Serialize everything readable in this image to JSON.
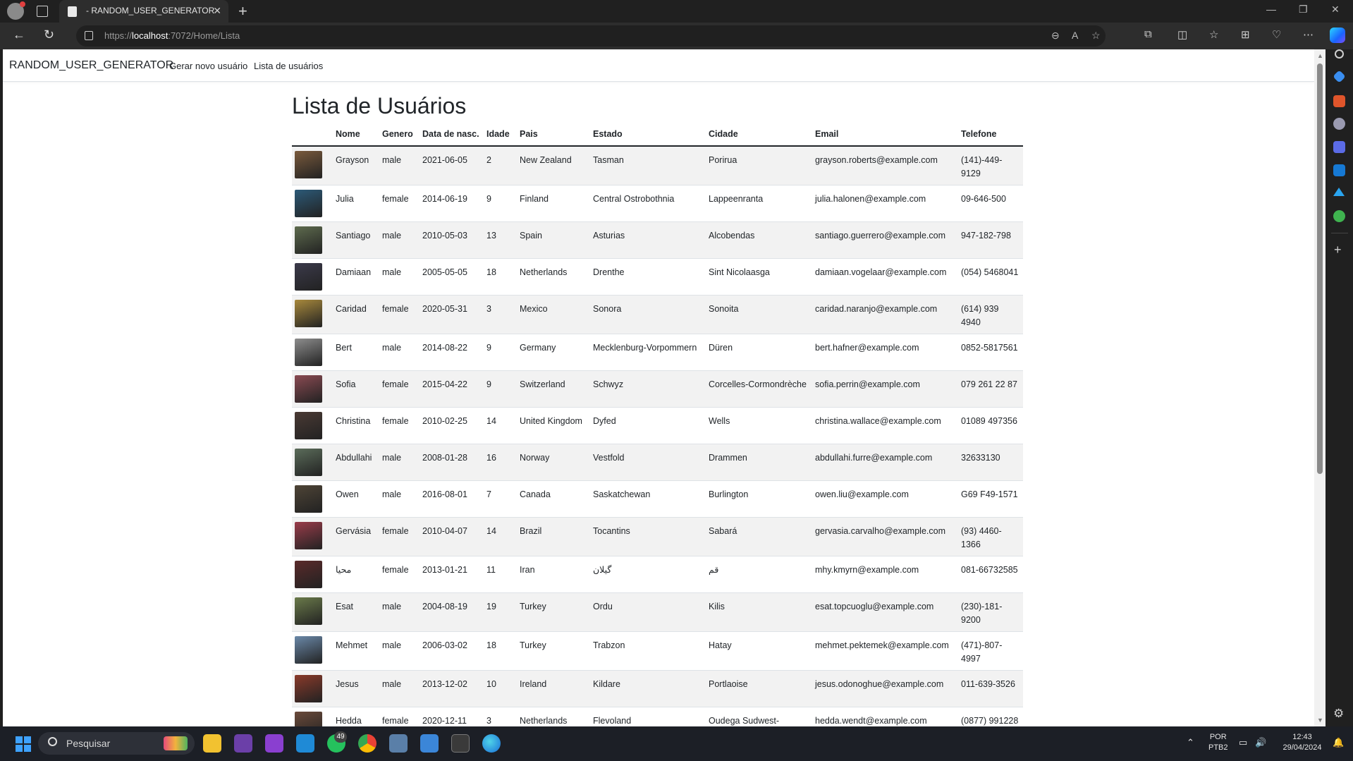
{
  "browser": {
    "tab_title": "- RANDOM_USER_GENERATOR",
    "url_scheme": "https://",
    "url_host": "localhost",
    "url_path": ":7072/Home/Lista"
  },
  "site": {
    "brand": "RANDOM_USER_GENERATOR",
    "nav": [
      "Gerar novo usuário",
      "Lista de usuários"
    ]
  },
  "page": {
    "title": "Lista de Usuários",
    "columns": [
      "",
      "Nome",
      "Genero",
      "Data de nasc.",
      "Idade",
      "Pais",
      "Estado",
      "Cidade",
      "Email",
      "Telefone"
    ],
    "users": [
      {
        "nome": "Grayson",
        "genero": "male",
        "nasc": "2021-06-05",
        "idade": "2",
        "pais": "New Zealand",
        "estado": "Tasman",
        "cidade": "Porirua",
        "email": "grayson.roberts@example.com",
        "telefone": "(141)-449-9129",
        "avatar_color": "#7a5a3c"
      },
      {
        "nome": "Julia",
        "genero": "female",
        "nasc": "2014-06-19",
        "idade": "9",
        "pais": "Finland",
        "estado": "Central Ostrobothnia",
        "cidade": "Lappeenranta",
        "email": "julia.halonen@example.com",
        "telefone": "09-646-500",
        "avatar_color": "#2c5a78"
      },
      {
        "nome": "Santiago",
        "genero": "male",
        "nasc": "2010-05-03",
        "idade": "13",
        "pais": "Spain",
        "estado": "Asturias",
        "cidade": "Alcobendas",
        "email": "santiago.guerrero@example.com",
        "telefone": "947-182-798",
        "avatar_color": "#5e6b4e"
      },
      {
        "nome": "Damiaan",
        "genero": "male",
        "nasc": "2005-05-05",
        "idade": "18",
        "pais": "Netherlands",
        "estado": "Drenthe",
        "cidade": "Sint Nicolaasga",
        "email": "damiaan.vogelaar@example.com",
        "telefone": "(054) 5468041",
        "avatar_color": "#3b3a4a"
      },
      {
        "nome": "Caridad",
        "genero": "female",
        "nasc": "2020-05-31",
        "idade": "3",
        "pais": "Mexico",
        "estado": "Sonora",
        "cidade": "Sonoita",
        "email": "caridad.naranjo@example.com",
        "telefone": "(614) 939 4940",
        "avatar_color": "#a8893c"
      },
      {
        "nome": "Bert",
        "genero": "male",
        "nasc": "2014-08-22",
        "idade": "9",
        "pais": "Germany",
        "estado": "Mecklenburg-Vorpommern",
        "cidade": "Düren",
        "email": "bert.hafner@example.com",
        "telefone": "0852-5817561",
        "avatar_color": "#8d8d8d"
      },
      {
        "nome": "Sofia",
        "genero": "female",
        "nasc": "2015-04-22",
        "idade": "9",
        "pais": "Switzerland",
        "estado": "Schwyz",
        "cidade": "Corcelles-Cormondrèche",
        "email": "sofia.perrin@example.com",
        "telefone": "079 261 22 87",
        "avatar_color": "#8a4a52"
      },
      {
        "nome": "Christina",
        "genero": "female",
        "nasc": "2010-02-25",
        "idade": "14",
        "pais": "United Kingdom",
        "estado": "Dyfed",
        "cidade": "Wells",
        "email": "christina.wallace@example.com",
        "telefone": "01089 497356",
        "avatar_color": "#4a3a34"
      },
      {
        "nome": "Abdullahi",
        "genero": "male",
        "nasc": "2008-01-28",
        "idade": "16",
        "pais": "Norway",
        "estado": "Vestfold",
        "cidade": "Drammen",
        "email": "abdullahi.furre@example.com",
        "telefone": "32633130",
        "avatar_color": "#5b6c5a"
      },
      {
        "nome": "Owen",
        "genero": "male",
        "nasc": "2016-08-01",
        "idade": "7",
        "pais": "Canada",
        "estado": "Saskatchewan",
        "cidade": "Burlington",
        "email": "owen.liu@example.com",
        "telefone": "G69 F49-1571",
        "avatar_color": "#4e4436"
      },
      {
        "nome": "Gervásia",
        "genero": "female",
        "nasc": "2010-04-07",
        "idade": "14",
        "pais": "Brazil",
        "estado": "Tocantins",
        "cidade": "Sabará",
        "email": "gervasia.carvalho@example.com",
        "telefone": "(93) 4460-1366",
        "avatar_color": "#9a3c4a"
      },
      {
        "nome": "محیا",
        "genero": "female",
        "nasc": "2013-01-21",
        "idade": "11",
        "pais": "Iran",
        "estado": "گیلان",
        "cidade": "قم",
        "email": "mhy.kmyrn@example.com",
        "telefone": "081-66732585",
        "avatar_color": "#5a2a2a"
      },
      {
        "nome": "Esat",
        "genero": "male",
        "nasc": "2004-08-19",
        "idade": "19",
        "pais": "Turkey",
        "estado": "Ordu",
        "cidade": "Kilis",
        "email": "esat.topcuoglu@example.com",
        "telefone": "(230)-181-9200",
        "avatar_color": "#6a7a4a"
      },
      {
        "nome": "Mehmet",
        "genero": "male",
        "nasc": "2006-03-02",
        "idade": "18",
        "pais": "Turkey",
        "estado": "Trabzon",
        "cidade": "Hatay",
        "email": "mehmet.pektemek@example.com",
        "telefone": "(471)-807-4997",
        "avatar_color": "#6a88a8"
      },
      {
        "nome": "Jesus",
        "genero": "male",
        "nasc": "2013-12-02",
        "idade": "10",
        "pais": "Ireland",
        "estado": "Kildare",
        "cidade": "Portlaoise",
        "email": "jesus.odonoghue@example.com",
        "telefone": "011-639-3526",
        "avatar_color": "#8a3a2a"
      },
      {
        "nome": "Hedda",
        "genero": "female",
        "nasc": "2020-12-11",
        "idade": "3",
        "pais": "Netherlands",
        "estado": "Flevoland",
        "cidade": "Oudega Sudwest-",
        "email": "hedda.wendt@example.com",
        "telefone": "(0877) 991228",
        "avatar_color": "#6a4a3a"
      }
    ]
  },
  "taskbar": {
    "search_placeholder": "Pesquisar",
    "badge": "49",
    "lang": "POR",
    "layout": "PTB2",
    "time": "12:43",
    "date": "29/04/2024"
  }
}
